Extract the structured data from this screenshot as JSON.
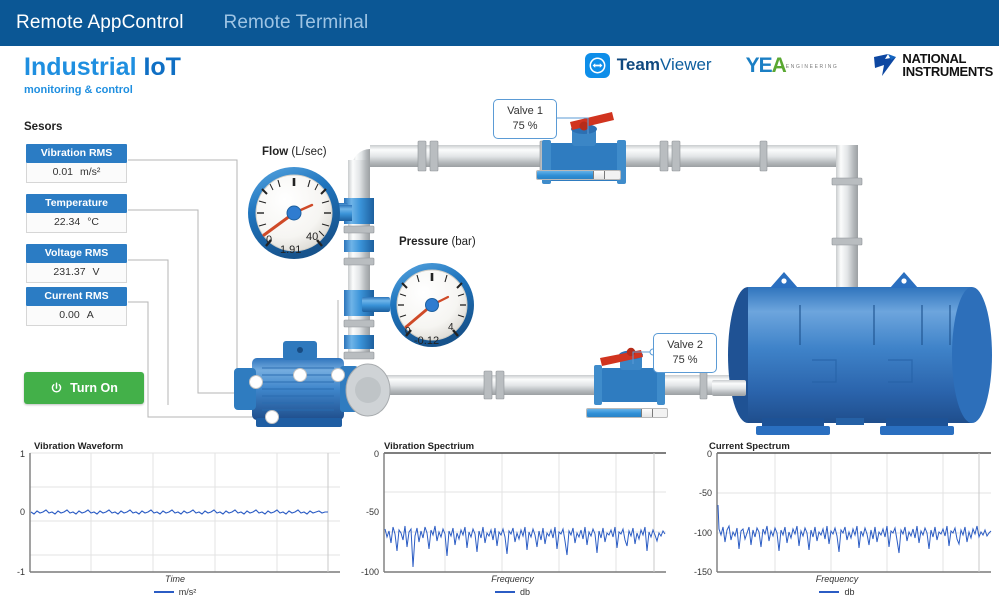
{
  "nav": {
    "tabs": [
      {
        "label": "Remote AppControl",
        "active": true
      },
      {
        "label": "Remote Terminal",
        "active": false
      }
    ]
  },
  "brand": {
    "title_1": "Industrial ",
    "title_2": "IoT",
    "subtitle": "monitoring & control"
  },
  "logos": {
    "teamviewer": {
      "bold": "Team",
      "light": "Viewer"
    },
    "yea": {
      "y": "Y",
      "e": "E",
      "a": "A",
      "subtitle": "ENGINEERING"
    },
    "ni": {
      "line1": "NATIONAL",
      "line2": "INSTRUMENTS"
    }
  },
  "sensors": {
    "title": "Sesors",
    "items": [
      {
        "name": "Vibration RMS",
        "value": "0.01",
        "unit": "m/s²"
      },
      {
        "name": "Temperature",
        "value": "22.34",
        "unit": "°C"
      },
      {
        "name": "Voltage RMS",
        "value": "231.37",
        "unit": "V"
      },
      {
        "name": "Current RMS",
        "value": "0.00",
        "unit": "A"
      }
    ]
  },
  "controls": {
    "power_button": "Turn On"
  },
  "gauges": [
    {
      "name": "Flow",
      "unit": "(L/sec)",
      "value": "1.91",
      "min_label": "0",
      "max_label": "40",
      "min": 0,
      "max": 40,
      "needle_angle": -115
    },
    {
      "name": "Pressure",
      "unit": "(bar)",
      "value": "-0.12",
      "min_label": "0",
      "max_label": "4",
      "min": 0,
      "max": 4,
      "needle_angle": -122
    }
  ],
  "valves": [
    {
      "label": "Valve 1",
      "value": "75 %",
      "percent": 75
    },
    {
      "label": "Valve 2",
      "value": "75 %",
      "percent": 75
    }
  ],
  "chart_data": [
    {
      "type": "line",
      "title": "Vibration Waveform",
      "xlabel": "Time",
      "ylabel": "",
      "legend": [
        "m/s²"
      ],
      "legend_position": "bottom",
      "grid": true,
      "ylim": [
        -1,
        1
      ],
      "yticks": [
        1,
        0,
        -1
      ],
      "ytick_labels": [
        "1",
        "0",
        "-1"
      ],
      "series": [
        {
          "name": "m/s²",
          "color": "#2b5cc4",
          "noise_center": 0.0,
          "noise_amplitude": 0.022,
          "n_points": 300,
          "values": [
            0.004,
            -0.012,
            0.009,
            0.015,
            -0.007,
            0.011,
            -0.018,
            0.006,
            0.013,
            -0.004,
            0.017,
            -0.011,
            0.002,
            0.008,
            -0.015,
            0.012,
            0.005,
            -0.009,
            0.014,
            -0.006,
            0.01,
            0.003,
            -0.013,
            0.016,
            -0.002,
            0.007,
            -0.017,
            0.011,
            0.004,
            -0.01
          ]
        }
      ]
    },
    {
      "type": "line",
      "title": "Vibration Spectrium",
      "xlabel": "Frequency",
      "ylabel": "",
      "legend": [
        "db"
      ],
      "legend_position": "bottom",
      "grid": true,
      "ylim": [
        -100,
        0
      ],
      "yticks": [
        0,
        -50,
        -100
      ],
      "ytick_labels": [
        "0",
        "-50",
        "-100"
      ],
      "series": [
        {
          "name": "db",
          "color": "#2b5cc4",
          "noise_center": -66,
          "noise_amplitude": 7,
          "noise_spikes": -94,
          "n_points": 300,
          "values": [
            -64,
            -72,
            -67,
            -78,
            -65,
            -70,
            -86,
            -66,
            -69,
            -75,
            -63,
            -80,
            -68,
            -66,
            -94,
            -71,
            -65,
            -77,
            -67,
            -73,
            -64,
            -69,
            -82,
            -66,
            -70,
            -63,
            -76,
            -68,
            -72,
            -65
          ]
        }
      ]
    },
    {
      "type": "line",
      "title": "Current Spectrum",
      "xlabel": "Frequency",
      "ylabel": "",
      "legend": [
        "db"
      ],
      "legend_position": "bottom",
      "grid": true,
      "ylim": [
        -150,
        0
      ],
      "yticks": [
        0,
        -50,
        -100,
        -150
      ],
      "ytick_labels": [
        "0",
        "-50",
        "-100",
        "-150"
      ],
      "series": [
        {
          "name": "db",
          "color": "#2b5cc4",
          "noise_center": -99,
          "noise_amplitude": 9,
          "first_point": -65,
          "n_points": 300,
          "values": [
            -65,
            -96,
            -104,
            -95,
            -110,
            -97,
            -93,
            -108,
            -99,
            -102,
            -94,
            -115,
            -98,
            -96,
            -106,
            -100,
            -93,
            -112,
            -97,
            -103,
            -95,
            -99,
            -118,
            -96,
            -101,
            -94,
            -109,
            -98,
            -105,
            -97
          ]
        }
      ]
    }
  ],
  "colors": {
    "header_blue": "#0b5795",
    "brand_blue": "#1f8fe0",
    "sensor_header": "#2b7cc4",
    "button_green": "#43b049",
    "pipe_blue": "#2f8fd6",
    "tank_blue": "#2a6fc0",
    "trace_blue": "#2b5cc4",
    "valve_handle_red": "#d1341f"
  }
}
